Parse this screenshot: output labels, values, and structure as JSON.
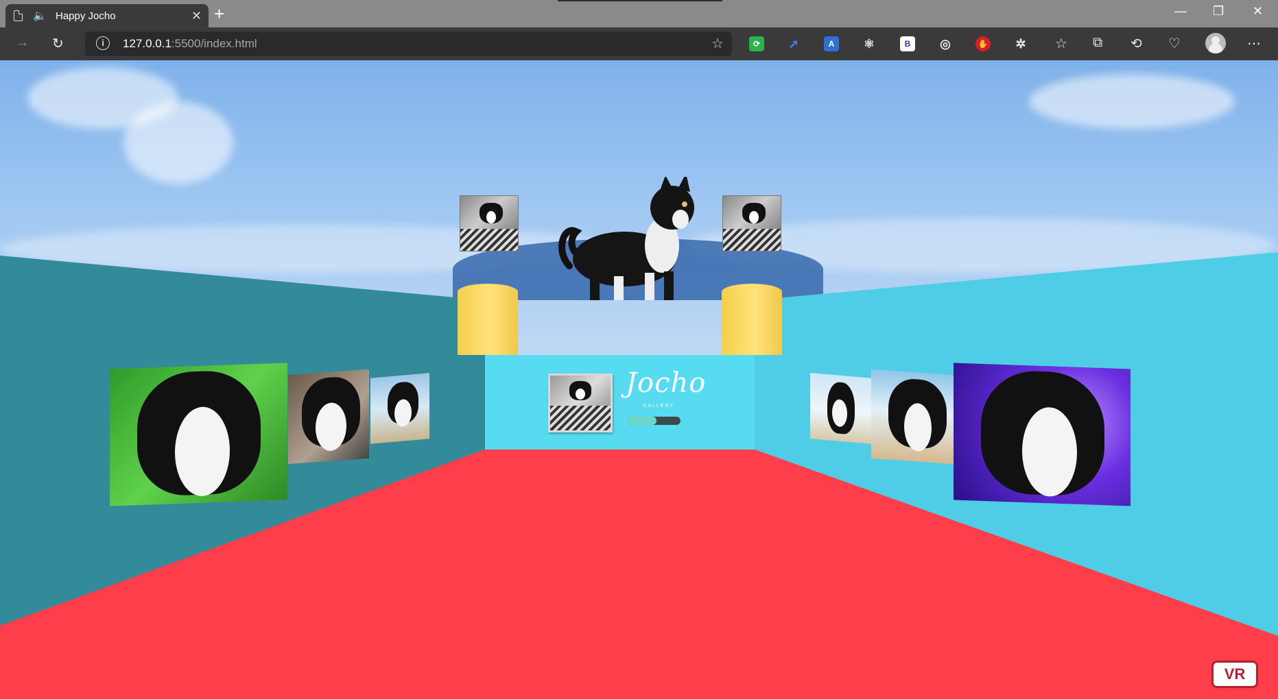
{
  "browser": {
    "tab_title": "Happy Jocho",
    "url_host": "127.0.0.1",
    "url_path": ":5500/index.html",
    "new_tab": "+",
    "tab_close": "✕",
    "minimize": "—",
    "restore": "❐",
    "close": "✕"
  },
  "gallery": {
    "title": "Jocho",
    "subtitle": "GALLERY",
    "loading_progress": 0.55
  },
  "vr_button": "VR",
  "colors": {
    "floor": "#ff3e4c",
    "left_wall": "#338a98",
    "right_wall": "#4fcde6",
    "center_wall": "#57dbf1",
    "pillar": "#ffde66",
    "vr_accent": "#b7202e"
  }
}
